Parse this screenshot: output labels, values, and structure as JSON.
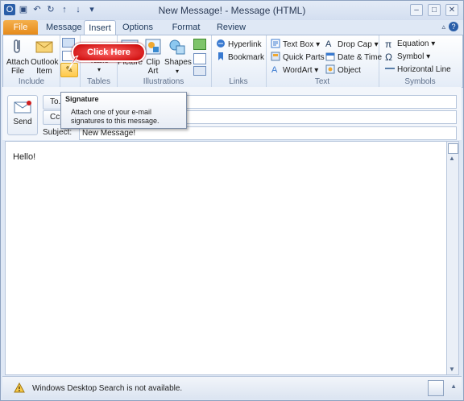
{
  "window": {
    "title": "New Message! - Message (HTML)",
    "qat_icons": [
      "outlook-icon",
      "save-icon",
      "undo-icon",
      "redo-icon",
      "previous-icon",
      "next-icon",
      "customize-qat-icon"
    ]
  },
  "tabs": [
    {
      "label": "File"
    },
    {
      "label": "Message"
    },
    {
      "label": "Insert"
    },
    {
      "label": "Options"
    },
    {
      "label": "Format Text"
    },
    {
      "label": "Review"
    }
  ],
  "ribbon": {
    "include": {
      "label": "Include",
      "attach_file": "Attach\nFile",
      "attach_file_l1": "Attach",
      "attach_file_l2": "File",
      "outlook_item_l1": "Outlook",
      "outlook_item_l2": "Item"
    },
    "tables": {
      "label": "Tables",
      "table": "Table"
    },
    "illustrations": {
      "label": "Illustrations",
      "picture": "Picture",
      "clip_art_l1": "Clip",
      "clip_art_l2": "Art",
      "shapes": "Shapes"
    },
    "links": {
      "label": "Links",
      "hyperlink": "Hyperlink",
      "bookmark": "Bookmark"
    },
    "text": {
      "label": "Text",
      "text_box": "Text Box",
      "quick_parts": "Quick Parts",
      "wordart": "WordArt",
      "drop_cap": "Drop Cap",
      "date_time": "Date & Time",
      "object": "Object"
    },
    "symbols": {
      "label": "Symbols",
      "equation": "Equation",
      "symbol": "Symbol",
      "horizontal_line": "Horizontal Line"
    }
  },
  "callout": {
    "text": "Click Here"
  },
  "tooltip": {
    "title": "Signature",
    "line1": "Attach one of your e-mail",
    "line2": "signatures to this message."
  },
  "header": {
    "send": "Send",
    "to": "To...",
    "cc": "Cc...",
    "subject_label": "Subject:",
    "subject_value": "New Message!"
  },
  "body": {
    "text": "Hello!"
  },
  "statusbar": {
    "message": "Windows Desktop Search is not available."
  },
  "colors": {
    "accent": "#e68a1a",
    "callout": "#c80000",
    "ribbon_border": "#a9bbd6"
  }
}
